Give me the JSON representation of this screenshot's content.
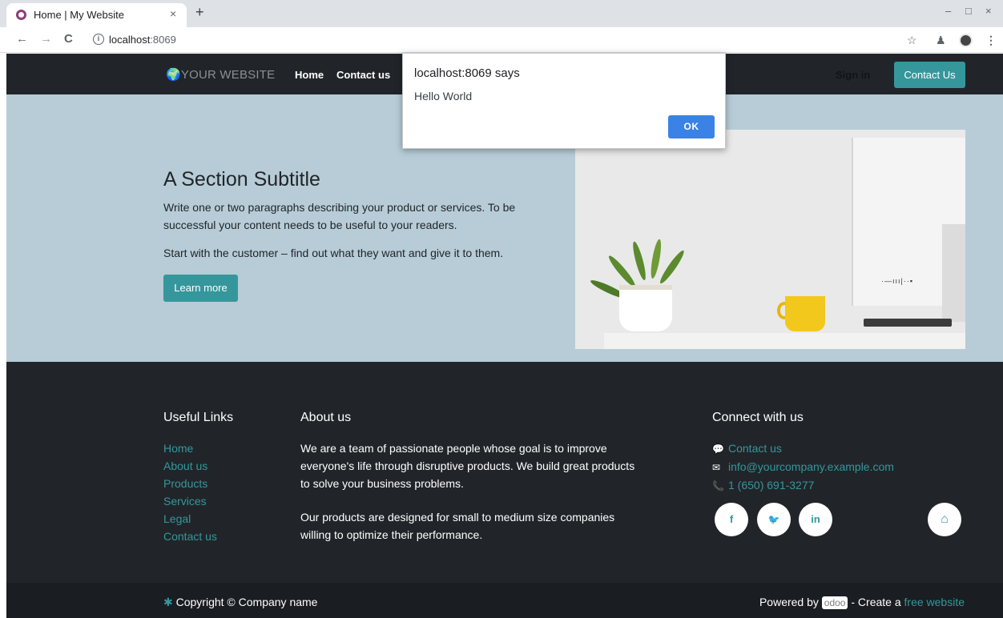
{
  "browser": {
    "tab_title": "Home | My Website",
    "tab_close": "×",
    "new_tab": "+",
    "url_host": "localhost",
    "url_port": ":8069",
    "window_controls": {
      "minimize": "–",
      "maximize": "□",
      "close": "×"
    },
    "back": "←",
    "forward": "→",
    "reload": "C",
    "star": "☆",
    "extensions": "♟",
    "menu": "⋮"
  },
  "site_header": {
    "logo_text": "YOUR WEBSITE",
    "nav": [
      "Home",
      "Contact us"
    ],
    "sign_in": "Sign in",
    "cta": "Contact Us"
  },
  "dialog": {
    "title": "localhost:8069 says",
    "message": "Hello World",
    "ok": "OK"
  },
  "hero": {
    "subtitle": "A Section Subtitle",
    "paragraph1": "Write one or two paragraphs describing your product or services. To be successful your content needs to be useful to your readers.",
    "paragraph2": "Start with the customer – find out what they want and give it to them.",
    "button": "Learn more"
  },
  "footer": {
    "useful_links_heading": "Useful Links",
    "useful_links": [
      "Home",
      "About us",
      "Products",
      "Services",
      "Legal",
      "Contact us"
    ],
    "about_heading": "About us",
    "about_p1": "We are a team of passionate people whose goal is to improve everyone's life through disruptive products. We build great products to solve your business problems.",
    "about_p2": "Our products are designed for small to medium size companies willing to optimize their performance.",
    "connect_heading": "Connect with us",
    "connect": {
      "contact": "Contact us",
      "email": "info@yourcompany.example.com",
      "phone": "1 (650) 691-3277"
    },
    "social": {
      "facebook": "f",
      "twitter": "🐦",
      "linkedin": "in",
      "home": "⌂"
    }
  },
  "copyright": {
    "left": "Copyright © Company name",
    "powered_by": "Powered by",
    "odoo": "odoo",
    "create": "- Create a",
    "free_website": "free website"
  },
  "colors": {
    "accent": "#35979c",
    "header_bg": "#212529",
    "hero_bg": "#b7ccd7",
    "dialog_ok": "#3b82e6"
  }
}
